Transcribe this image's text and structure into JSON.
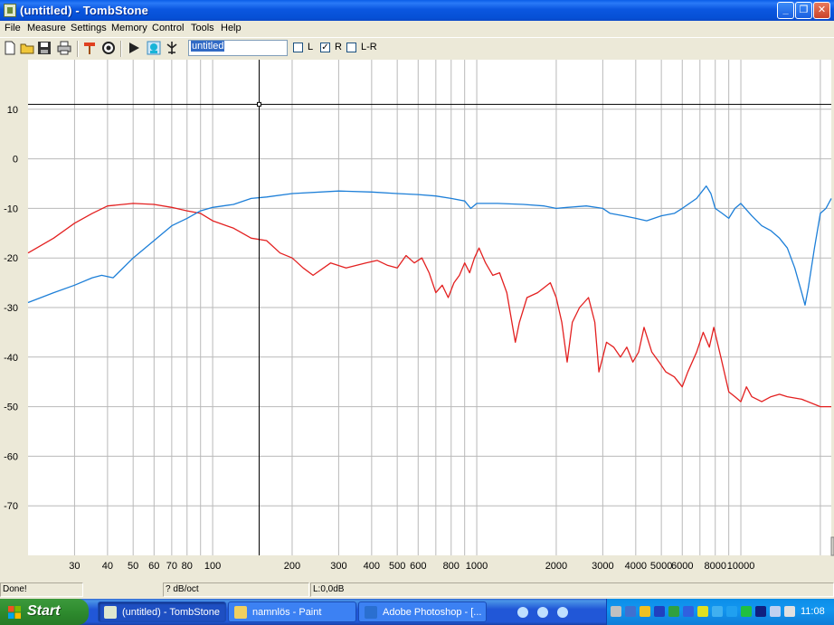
{
  "window": {
    "title": "(untitled) - TombStone",
    "min_glyph": "_",
    "max_glyph": "❐",
    "close_glyph": "✕"
  },
  "menu": [
    "File",
    "Measure",
    "Settings",
    "Memory",
    "Control",
    "Tools",
    "Help"
  ],
  "toolbar": {
    "icons": [
      "new-icon",
      "open-icon",
      "save-icon",
      "print-icon",
      "probe-icon",
      "target-icon",
      "play-icon",
      "monitor-icon",
      "tuning-icon"
    ],
    "name_value": "untitled",
    "checkboxes": [
      {
        "label": "L",
        "checked": false
      },
      {
        "label": "R",
        "checked": true
      },
      {
        "label": "L-R",
        "checked": false
      }
    ],
    "check_glyph": "✓"
  },
  "status": {
    "left": "Done!",
    "middle": "? dB/oct",
    "right": "L:0,0dB"
  },
  "taskbar": {
    "start": "Start",
    "tasks": [
      "(untitled) - TombStone",
      "namnlös - Paint",
      "Adobe Photoshop - [..."
    ],
    "clock": "11:08"
  },
  "colors": {
    "left_series": "#e32020",
    "right_series": "#1d7fd8",
    "grid": "#b9b9b9",
    "cursor": "#000000"
  },
  "chart_data": {
    "type": "line",
    "xscale": "log",
    "xlim": [
      20,
      22000
    ],
    "ylim": [
      -80,
      20
    ],
    "x_ticks": [
      "30",
      "40",
      "50",
      "60",
      "70",
      "80",
      "100",
      "200",
      "300",
      "400",
      "500",
      "600",
      "800",
      "1000",
      "2000",
      "3000",
      "4000",
      "5000",
      "6000",
      "8000",
      "10000"
    ],
    "x_tick_values": [
      30,
      40,
      50,
      60,
      70,
      80,
      100,
      200,
      300,
      400,
      500,
      600,
      800,
      1000,
      2000,
      3000,
      4000,
      5000,
      6000,
      8000,
      10000
    ],
    "y_ticks": [
      "10",
      "0",
      "-10",
      "-20",
      "-30",
      "-40",
      "-50",
      "-60",
      "-70"
    ],
    "y_tick_values": [
      10,
      0,
      -10,
      -20,
      -30,
      -40,
      -50,
      -60,
      -70
    ],
    "cursor": {
      "x": 150,
      "y": 11
    },
    "series": [
      {
        "key": "red",
        "points": [
          [
            20,
            -19
          ],
          [
            25,
            -16
          ],
          [
            30,
            -13
          ],
          [
            35,
            -11
          ],
          [
            40,
            -9.5
          ],
          [
            50,
            -9
          ],
          [
            60,
            -9.2
          ],
          [
            70,
            -9.8
          ],
          [
            80,
            -10.5
          ],
          [
            90,
            -11
          ],
          [
            100,
            -12.5
          ],
          [
            120,
            -14
          ],
          [
            140,
            -16
          ],
          [
            160,
            -16.5
          ],
          [
            180,
            -19
          ],
          [
            200,
            -20
          ],
          [
            220,
            -22
          ],
          [
            240,
            -23.5
          ],
          [
            280,
            -21
          ],
          [
            320,
            -22
          ],
          [
            380,
            -21
          ],
          [
            420,
            -20.5
          ],
          [
            460,
            -21.5
          ],
          [
            500,
            -22
          ],
          [
            540,
            -19.5
          ],
          [
            580,
            -21
          ],
          [
            620,
            -20
          ],
          [
            660,
            -23
          ],
          [
            700,
            -27
          ],
          [
            740,
            -25.5
          ],
          [
            780,
            -28
          ],
          [
            820,
            -25
          ],
          [
            860,
            -23.5
          ],
          [
            900,
            -21
          ],
          [
            940,
            -23
          ],
          [
            980,
            -20
          ],
          [
            1020,
            -18
          ],
          [
            1080,
            -21
          ],
          [
            1150,
            -23.5
          ],
          [
            1220,
            -23
          ],
          [
            1300,
            -27
          ],
          [
            1400,
            -37
          ],
          [
            1450,
            -33
          ],
          [
            1550,
            -28
          ],
          [
            1700,
            -27
          ],
          [
            1900,
            -25
          ],
          [
            2000,
            -28
          ],
          [
            2100,
            -33
          ],
          [
            2200,
            -41
          ],
          [
            2300,
            -33
          ],
          [
            2450,
            -30
          ],
          [
            2650,
            -28
          ],
          [
            2800,
            -33
          ],
          [
            2900,
            -43
          ],
          [
            3000,
            -40
          ],
          [
            3100,
            -37
          ],
          [
            3300,
            -38
          ],
          [
            3500,
            -40
          ],
          [
            3700,
            -38
          ],
          [
            3900,
            -41
          ],
          [
            4100,
            -39
          ],
          [
            4300,
            -34
          ],
          [
            4600,
            -39
          ],
          [
            4900,
            -41
          ],
          [
            5200,
            -43
          ],
          [
            5600,
            -44
          ],
          [
            6000,
            -46
          ],
          [
            6300,
            -43
          ],
          [
            6800,
            -39
          ],
          [
            7200,
            -35
          ],
          [
            7600,
            -38
          ],
          [
            7900,
            -34
          ],
          [
            8400,
            -40
          ],
          [
            9000,
            -47
          ],
          [
            9500,
            -48
          ],
          [
            10000,
            -49
          ],
          [
            10500,
            -46
          ],
          [
            11000,
            -48
          ],
          [
            12000,
            -49
          ],
          [
            13000,
            -48
          ],
          [
            14000,
            -47.5
          ],
          [
            15000,
            -48
          ],
          [
            17000,
            -48.5
          ],
          [
            20000,
            -50
          ],
          [
            22000,
            -50
          ]
        ]
      },
      {
        "key": "blue",
        "points": [
          [
            20,
            -29
          ],
          [
            25,
            -27
          ],
          [
            30,
            -25.5
          ],
          [
            35,
            -24
          ],
          [
            38,
            -23.5
          ],
          [
            42,
            -24
          ],
          [
            50,
            -20
          ],
          [
            60,
            -16.5
          ],
          [
            70,
            -13.5
          ],
          [
            80,
            -12
          ],
          [
            90,
            -10.5
          ],
          [
            100,
            -9.8
          ],
          [
            120,
            -9.2
          ],
          [
            140,
            -8
          ],
          [
            160,
            -7.7
          ],
          [
            200,
            -7
          ],
          [
            300,
            -6.5
          ],
          [
            400,
            -6.7
          ],
          [
            500,
            -7
          ],
          [
            600,
            -7.2
          ],
          [
            700,
            -7.5
          ],
          [
            800,
            -8
          ],
          [
            900,
            -8.5
          ],
          [
            950,
            -10
          ],
          [
            1000,
            -9
          ],
          [
            1200,
            -9
          ],
          [
            1500,
            -9.2
          ],
          [
            1800,
            -9.5
          ],
          [
            2000,
            -10
          ],
          [
            2200,
            -9.8
          ],
          [
            2600,
            -9.5
          ],
          [
            3000,
            -10
          ],
          [
            3200,
            -11
          ],
          [
            3600,
            -11.5
          ],
          [
            4000,
            -12
          ],
          [
            4400,
            -12.5
          ],
          [
            5000,
            -11.5
          ],
          [
            5600,
            -11
          ],
          [
            6000,
            -10
          ],
          [
            6800,
            -8
          ],
          [
            7400,
            -5.5
          ],
          [
            7700,
            -7
          ],
          [
            8000,
            -10
          ],
          [
            8500,
            -11
          ],
          [
            9000,
            -12
          ],
          [
            9500,
            -10
          ],
          [
            10000,
            -9
          ],
          [
            11000,
            -11.5
          ],
          [
            12000,
            -13.5
          ],
          [
            13000,
            -14.5
          ],
          [
            14000,
            -16
          ],
          [
            15000,
            -18
          ],
          [
            16000,
            -22
          ],
          [
            17000,
            -27
          ],
          [
            17500,
            -29.5
          ],
          [
            18000,
            -26
          ],
          [
            19000,
            -18
          ],
          [
            20000,
            -11
          ],
          [
            21000,
            -10
          ],
          [
            22000,
            -8
          ]
        ]
      }
    ]
  }
}
